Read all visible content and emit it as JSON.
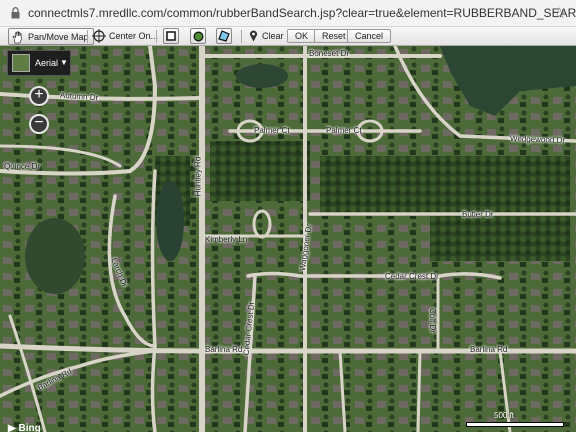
{
  "browser": {
    "url": "connectmls7.mredllc.com/common/rubberBandSearch.jsp?clear=true&element=RUBBERBAND_SEARCH"
  },
  "toolbar": {
    "pan_label": "Pan/Move Map",
    "center_label": "Center On...",
    "clear_label": "Clear",
    "ok_label": "OK",
    "reset_label": "Reset",
    "cancel_label": "Cancel"
  },
  "map": {
    "layer_label": "Aerial",
    "zoom_in": "+",
    "zoom_out": "−",
    "attribution": "Bing",
    "scale_label": "500 ft",
    "streets": {
      "boneset": "Boneset Dr",
      "autumn": "Autumn Dr",
      "palmer_ct": "Palmer Ct",
      "palmer_ct2": "Palmer Ct",
      "wedgewood": "Wedgewood Dr",
      "quince": "Quince Dr",
      "huntley": "Huntley Rd",
      "butler": "Butler Dr",
      "kimberly": "Kimberly Ln",
      "waggoner": "Waggoner Dr",
      "cedar_crest": "Cedar Crest Dr",
      "cedar_crest_v": "Cedar Crest Dr",
      "colt": "Colt Dr",
      "barlina": "Barlina Rd",
      "barlina2": "Barlina Rd",
      "barlina3": "Barlina Rd",
      "larch": "Larch Dr"
    }
  },
  "colors": {
    "aerial_green": "#3c5a2e",
    "road": "#d9d4c8",
    "pond": "#2f4a35"
  }
}
